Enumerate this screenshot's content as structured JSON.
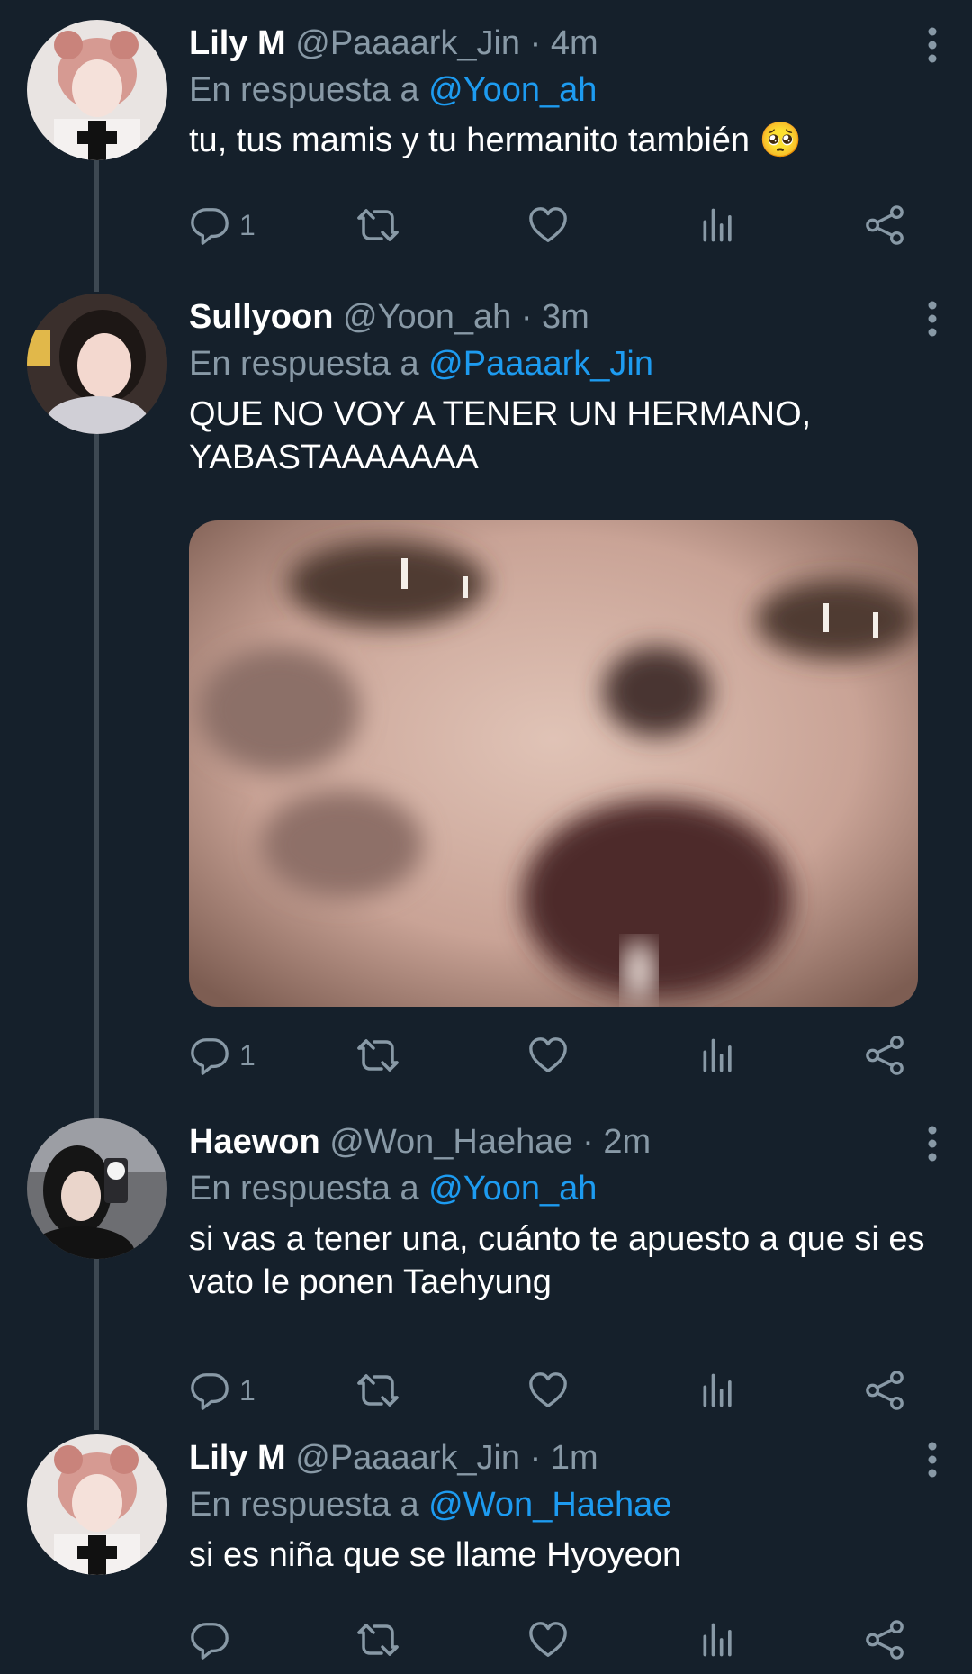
{
  "tweets": [
    {
      "name": "Lily M",
      "handle": "@Paaaark_Jin",
      "time": "· 4m",
      "reply_prefix": "En respuesta a",
      "reply_to": "@Yoon_ah",
      "text": "tu, tus mamis y tu hermanito también 🥺",
      "reply_count": "1"
    },
    {
      "name": "Sullyoon",
      "handle": "@Yoon_ah",
      "time": "· 3m",
      "reply_prefix": "En respuesta a",
      "reply_to": "@Paaaark_Jin",
      "text": "QUE NO VOY A TENER UN HERMANO, YABASTAAAAAAA",
      "reply_count": "1"
    },
    {
      "name": "Haewon",
      "handle": "@Won_Haehae",
      "time": "· 2m",
      "reply_prefix": "En respuesta a",
      "reply_to": "@Yoon_ah",
      "text": "si vas a tener una, cuánto te apuesto a que si es vato le ponen Taehyung",
      "reply_count": "1"
    },
    {
      "name": "Lily M",
      "handle": "@Paaaark_Jin",
      "time": "· 1m",
      "reply_prefix": "En respuesta a",
      "reply_to": "@Won_Haehae",
      "text": "si es niña que se llame Hyoyeon",
      "reply_count": ""
    }
  ],
  "theme": {
    "background": "#15202b",
    "muted": "#8899a6",
    "link": "#1d9bf0"
  },
  "icons": [
    "reply-icon",
    "retweet-icon",
    "like-icon",
    "views-icon",
    "share-icon",
    "more-icon"
  ]
}
